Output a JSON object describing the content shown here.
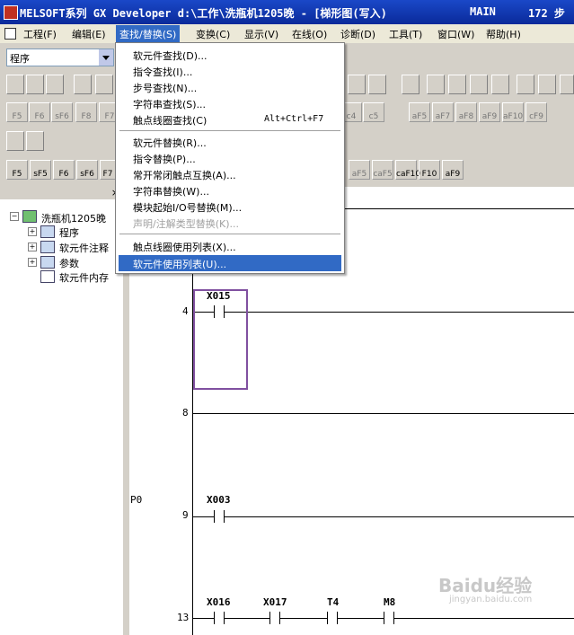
{
  "window": {
    "title": "MELSOFT系列 GX Developer d:\\工作\\洗瓶机1205晚 - [梯形图(写入)",
    "mode": "MAIN",
    "steps": "172 步"
  },
  "menubar": {
    "items": [
      "工程(F)",
      "编辑(E)",
      "查找/替换(S)",
      "变换(C)",
      "显示(V)",
      "在线(O)",
      "诊断(D)",
      "工具(T)",
      "窗口(W)",
      "帮助(H)"
    ]
  },
  "toolbar": {
    "program_combo": "程序"
  },
  "fkeys_row1": [
    "F5",
    "F6",
    "sF6",
    "F8",
    "F7",
    "c4",
    "c5",
    "aF5",
    "aF7",
    "aF8",
    "aF9",
    "aF10",
    "cF9"
  ],
  "fkeys_row3": [
    "F5",
    "sF5",
    "F6",
    "sF6",
    "F7",
    "aF5",
    "caF5",
    "caF10",
    "F10",
    "aF9"
  ],
  "search_menu": {
    "items": [
      {
        "label": "软元件查找(D)...",
        "shortcut": ""
      },
      {
        "label": "指令查找(I)...",
        "shortcut": ""
      },
      {
        "label": "步号查找(N)...",
        "shortcut": ""
      },
      {
        "label": "字符串查找(S)...",
        "shortcut": ""
      },
      {
        "label": "触点线圈查找(C)",
        "shortcut": "Alt+Ctrl+F7"
      },
      {
        "label": "软元件替换(R)...",
        "shortcut": ""
      },
      {
        "label": "指令替换(P)...",
        "shortcut": ""
      },
      {
        "label": "常开常闭触点互换(A)...",
        "shortcut": ""
      },
      {
        "label": "字符串替换(W)...",
        "shortcut": ""
      },
      {
        "label": "模块起始I/O号替换(M)...",
        "shortcut": ""
      },
      {
        "label": "声明/注解类型替换(K)...",
        "shortcut": ""
      },
      {
        "label": "触点线圈使用列表(X)...",
        "shortcut": ""
      },
      {
        "label": "软元件使用列表(U)...",
        "shortcut": ""
      }
    ]
  },
  "project_tree": {
    "root": "洗瓶机1205晚",
    "children": [
      "程序",
      "软元件注释",
      "参数",
      "软元件内存"
    ]
  },
  "ladder": {
    "label_p0": "P0",
    "rungs": [
      {
        "step": "4",
        "devices": [
          "X015"
        ]
      },
      {
        "step": "8",
        "devices": []
      },
      {
        "step": "9",
        "devices": [
          "X003"
        ]
      },
      {
        "step": "13",
        "devices": [
          "X016",
          "X017",
          "T4",
          "M8"
        ]
      }
    ]
  },
  "watermark": {
    "logo": "Baidu经验",
    "url": "jingyan.baidu.com"
  }
}
